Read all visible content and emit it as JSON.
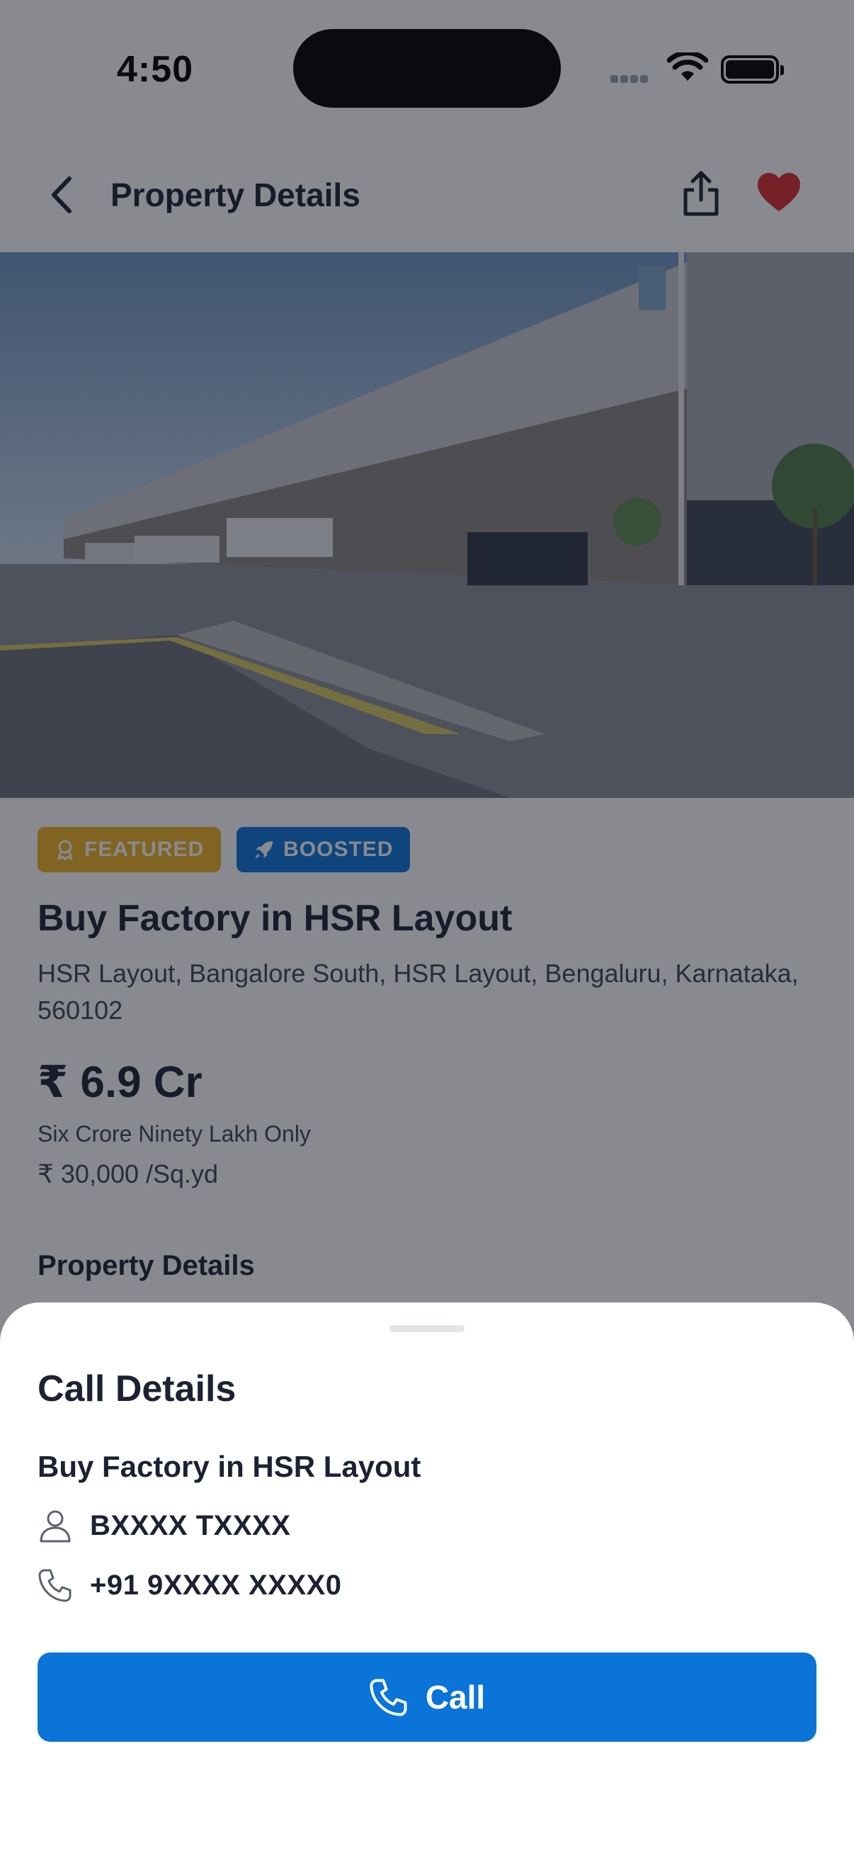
{
  "status_bar": {
    "time": "4:50"
  },
  "nav": {
    "title": "Property Details"
  },
  "listing": {
    "badges": [
      {
        "label": "FEATURED",
        "color": "#f0b323"
      },
      {
        "label": "BOOSTED",
        "color": "#0a74d8"
      }
    ],
    "title": "Buy Factory in HSR Layout",
    "address": "HSR Layout, Bangalore South, HSR Layout, Bengaluru, Karnataka, 560102",
    "price": "₹ 6.9 Cr",
    "price_words": "Six Crore Ninety Lakh Only",
    "price_rate": "₹ 30,000 /Sq.yd",
    "section_heading": "Property Details"
  },
  "sheet": {
    "title": "Call Details",
    "subtitle": "Buy Factory in HSR Layout",
    "contact_name": "BXXXX TXXXX",
    "contact_phone": "+91 9XXXX XXXX0",
    "call_label": "Call"
  },
  "icons": {
    "back": "chevron-left-icon",
    "share": "share-icon",
    "favorite": "heart-icon",
    "featured": "award-icon",
    "boosted": "rocket-icon",
    "person": "user-icon",
    "phone": "phone-icon"
  },
  "colors": {
    "accent": "#0a74d8",
    "featured": "#f0b323",
    "favorite": "#d92d2d",
    "text_primary": "#1c2233"
  }
}
